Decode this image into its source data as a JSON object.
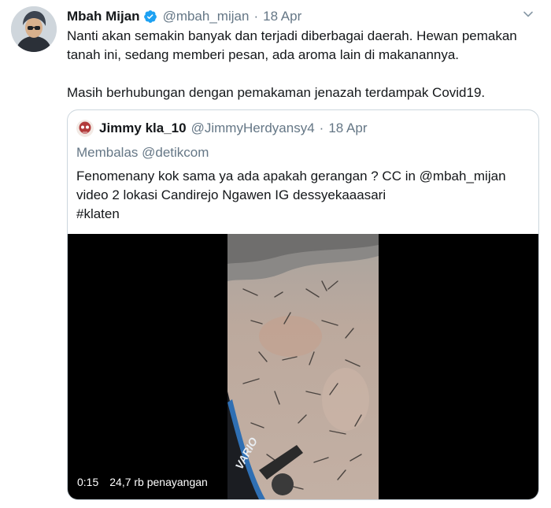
{
  "tweet": {
    "display_name": "Mbah Mijan",
    "handle": "@mbah_mijan",
    "separator": "·",
    "date": "18 Apr",
    "text_lines": [
      "Nanti akan semakin banyak dan terjadi diberbagai daerah. Hewan pemakan tanah ini, sedang memberi pesan, ada aroma lain di makanannya.",
      "Masih berhubungan dengan pemakaman jenazah terdampak Covid19."
    ],
    "verified_icon": "verified-badge-icon",
    "menu_icon": "chevron-down-icon"
  },
  "quote": {
    "display_name": "Jimmy kla_10",
    "handle": "@JimmyHerdyansy4",
    "separator": "·",
    "date": "18 Apr",
    "reply_to": "Membalas @detikcom",
    "text_lines": [
      "Fenomenany kok sama ya ada apakah gerangan ? CC in @mbah_mijan",
      "video 2 lokasi Candirejo Ngawen IG dessyekaaasari",
      "#klaten"
    ],
    "video": {
      "duration": "0:15",
      "views": "24,7 rb penayangan",
      "frame_text": "VARIO"
    }
  },
  "colors": {
    "text": "#14171a",
    "muted": "#657786",
    "border": "#ccd6dd",
    "verified": "#1da1f2"
  }
}
